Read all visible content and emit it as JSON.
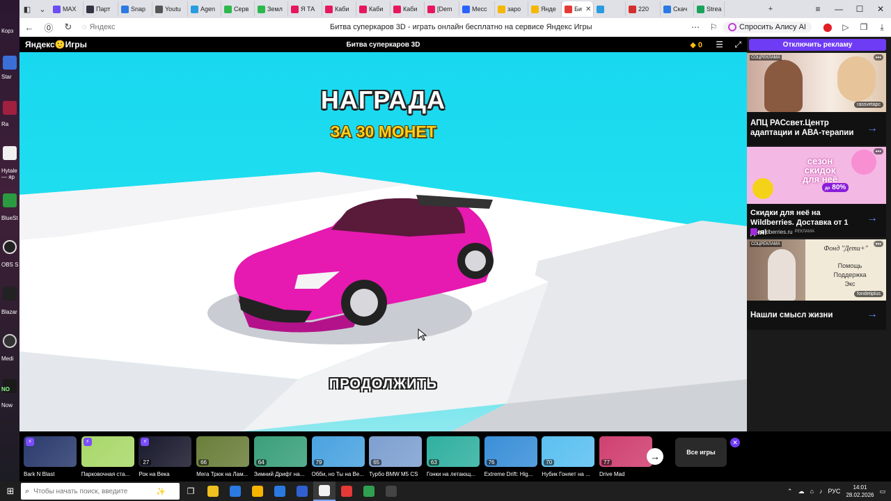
{
  "browser": {
    "tabs": [
      {
        "label": "MAX",
        "color": "#6b4cf5"
      },
      {
        "label": "Парт",
        "color": "#334"
      },
      {
        "label": "Snap",
        "color": "#2a7ae2"
      },
      {
        "label": "Youtu",
        "color": "#555"
      },
      {
        "label": "Agen",
        "color": "#2a9be0"
      },
      {
        "label": "Серв",
        "color": "#2db84d"
      },
      {
        "label": "Земл",
        "color": "#2db84d"
      },
      {
        "label": "Я ТА",
        "color": "#e8175d"
      },
      {
        "label": "Каби",
        "color": "#e8175d"
      },
      {
        "label": "Каби",
        "color": "#e8175d"
      },
      {
        "label": "Каби",
        "color": "#e8175d"
      },
      {
        "label": "[Dem",
        "color": "#e8175d"
      },
      {
        "label": "Месс",
        "color": "#2962ff"
      },
      {
        "label": "заро",
        "color": "#f6b700"
      },
      {
        "label": "Янде",
        "color": "#f6b700"
      },
      {
        "label": "Би",
        "color": "#e53935"
      },
      {
        "label": "",
        "color": "#2a9be0"
      },
      {
        "label": "220",
        "color": "#d32f2f"
      },
      {
        "label": "Скач",
        "color": "#2a7ae2"
      },
      {
        "label": "Strea",
        "color": "#1aa35a"
      }
    ],
    "address_placeholder": "Яндекс",
    "page_title": "Битва суперкаров 3D - играть онлайн бесплатно на сервисе Яндекс Игры",
    "alice_label": "Спросить Алису AI"
  },
  "yandex_games": {
    "logo": "Яндекс🙂Игры",
    "game_title": "Битва суперкаров 3D",
    "coins": "0"
  },
  "game": {
    "reward_title": "НАГРАДА",
    "reward_subtitle": "ЗА 30 МОНЕТ",
    "continue_label": "ПРОДОЛЖИТЬ"
  },
  "ads": {
    "disable_label": "Отключить рекламу",
    "items": [
      {
        "tag": "СОЦРЕКЛАМА",
        "brand": "rassvetapc",
        "text": "АПЦ РАСсвет.Центр адаптации и АВА-терапии"
      },
      {
        "tag": "",
        "brand": "",
        "text": "Скидки для неё на Wildberries. Доставка от 1 дня!",
        "source": "wildberries.ru",
        "source_tag": "РЕКЛАМА",
        "promo_line1": "сезон",
        "promo_line2": "скидок",
        "promo_line3": "для неё",
        "promo_pct": "80%",
        "promo_prefix": "до"
      },
      {
        "tag": "СОЦРЕКЛАМА",
        "brand": "fondetiplus",
        "text": "Нашли смысл жизни",
        "sign": "Фонд \"Дети+\"",
        "list": [
          "Помощь",
          "Поддержка",
          "Экс"
        ]
      }
    ]
  },
  "rail": {
    "games": [
      {
        "name": "Bark N Blast",
        "count": "",
        "color": "#2b3b6e",
        "bolt": true
      },
      {
        "name": "Парковочная ста...",
        "count": "",
        "color": "#a9d86a",
        "bolt": true
      },
      {
        "name": "Рок на Века",
        "count": "27",
        "color": "#1a1a2e",
        "bolt": true
      },
      {
        "name": "Мега Трюк на Лам...",
        "count": "66",
        "color": "#6b7f3a",
        "bolt": false
      },
      {
        "name": "Зимний Дрифт на...",
        "count": "64",
        "color": "#3aa07a",
        "bolt": false
      },
      {
        "name": "Обби, но Ты на Ве...",
        "count": "79",
        "color": "#4aa3e0",
        "bolt": false
      },
      {
        "name": "Турбо BMW M5 CS",
        "count": "65",
        "color": "#7ea0d0",
        "bolt": false
      },
      {
        "name": "Гонки на летающ...",
        "count": "63",
        "color": "#30b0a0",
        "bolt": false
      },
      {
        "name": "Extreme Drift: Hig...",
        "count": "76",
        "color": "#3a8fd8",
        "bolt": false
      },
      {
        "name": "Нубик Гоняет на ...",
        "count": "70",
        "color": "#5bc0f0",
        "bolt": false
      },
      {
        "name": "Drive Mad",
        "count": "77",
        "color": "#d04070",
        "bolt": false
      }
    ],
    "all_games": "Все игры"
  },
  "taskbar": {
    "search_placeholder": "Чтобы начать поиск, введите",
    "lang": "РУС",
    "time": "14:01",
    "date": "28.02.2026",
    "apps": [
      "#f0c020",
      "#2a7ae2",
      "#f5b400",
      "#2a7ae2",
      "#3060d0",
      "#f2f2f2",
      "#e53935",
      "#30a050",
      "#444"
    ]
  },
  "desktop": {
    "labels": [
      "Корз",
      "Star",
      "Ra",
      "Hytale — яр",
      "BlueSt",
      "OBS S",
      "Blazar",
      "Medi",
      "NO",
      "Now"
    ]
  }
}
